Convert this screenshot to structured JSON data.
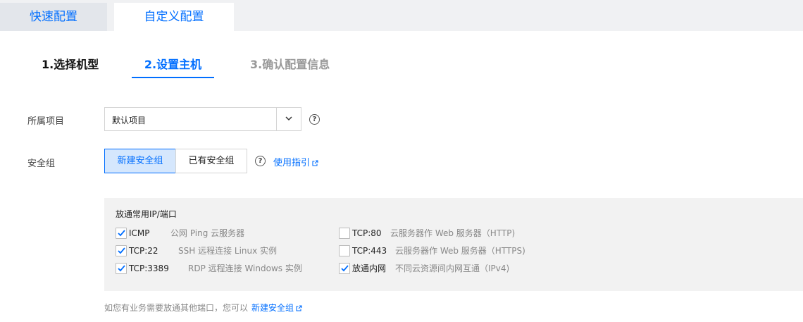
{
  "top_tabs": [
    {
      "label": "快速配置"
    },
    {
      "label": "自定义配置"
    }
  ],
  "steps": [
    {
      "label": "1.选择机型"
    },
    {
      "label": "2.设置主机"
    },
    {
      "label": "3.确认配置信息"
    }
  ],
  "form": {
    "project_label": "所属项目",
    "project_value": "默认项目",
    "security_group_label": "安全组",
    "new_sg_label": "新建安全组",
    "existing_sg_label": "已有安全组",
    "help_glyph": "?",
    "guide_link": "使用指引"
  },
  "ports": {
    "title": "放通常用IP/端口",
    "items": [
      {
        "name": "ICMP",
        "desc": "公网 Ping 云服务器",
        "checked": true
      },
      {
        "name": "TCP:22",
        "desc": "SSH 远程连接 Linux 实例",
        "checked": true
      },
      {
        "name": "TCP:3389",
        "desc": "RDP 远程连接 Windows 实例",
        "checked": true
      },
      {
        "name": "TCP:80",
        "desc": "云服务器作 Web 服务器（HTTP)",
        "checked": false
      },
      {
        "name": "TCP:443",
        "desc": "云服务器作 Web 服务器（HTTPS)",
        "checked": false
      },
      {
        "name": "放通内网",
        "desc": "不同云资源间内网互通（IPv4)",
        "checked": true
      }
    ]
  },
  "footer": {
    "note": "如您有业务需要放通其他端口，您可以",
    "link": "新建安全组"
  },
  "colors": {
    "accent": "#006eff",
    "panel_bg": "#f2f2f2",
    "selected_segment_bg": "#d5e7fd"
  },
  "icons": {
    "select_arrow": "chevron-down-icon",
    "help": "help-circle-icon",
    "external": "external-link-icon",
    "check": "checkmark-icon"
  }
}
